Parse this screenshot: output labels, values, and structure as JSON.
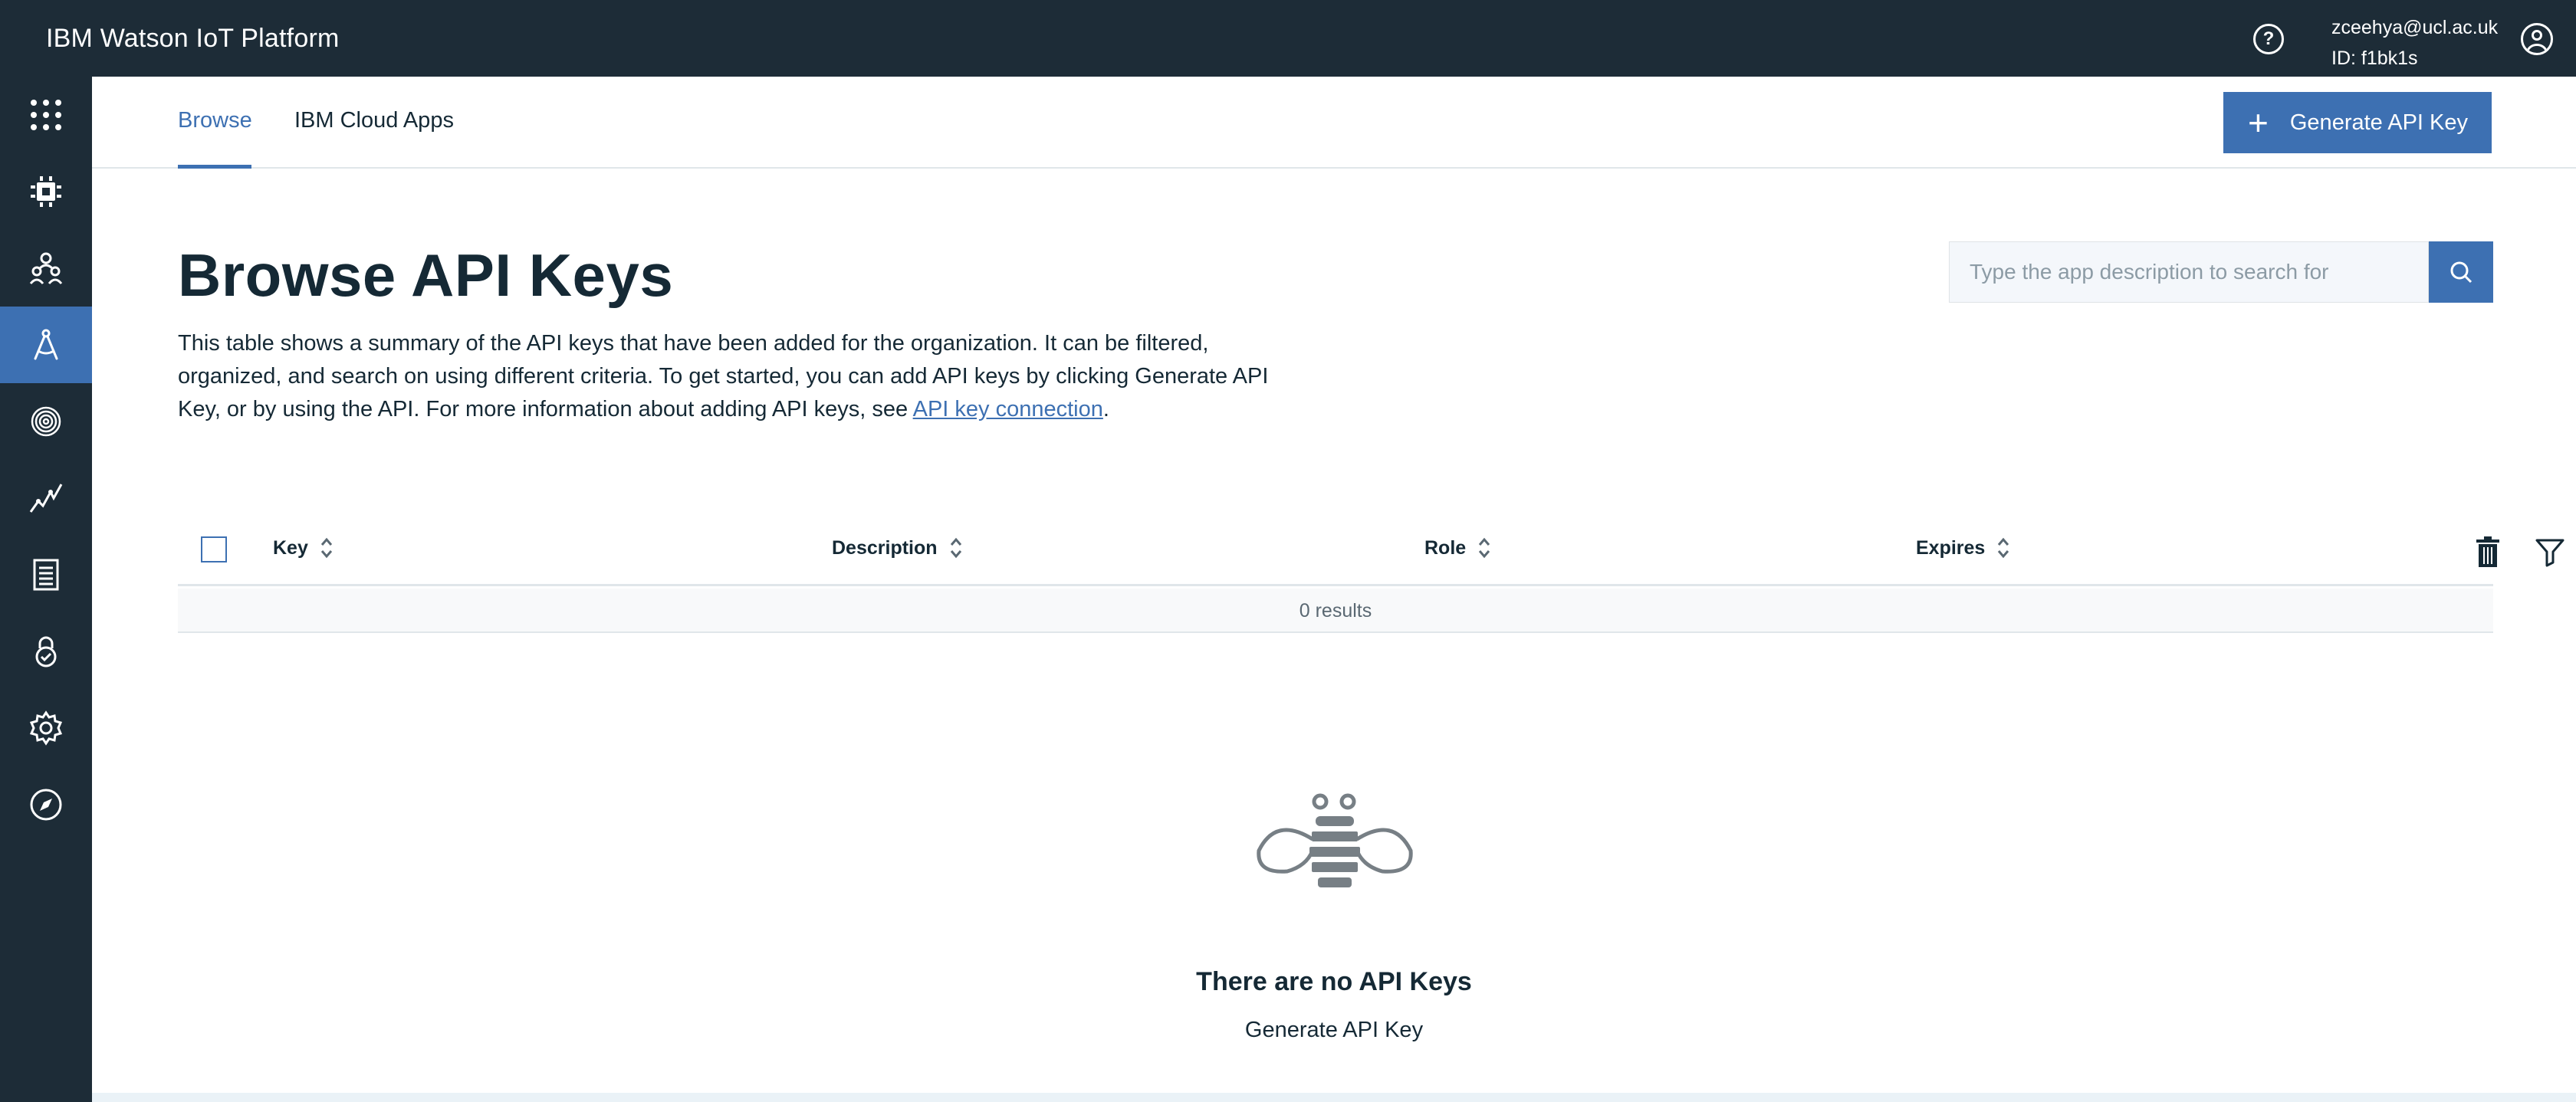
{
  "header": {
    "app_title": "IBM Watson IoT Platform",
    "help_icon": "help-circle-icon",
    "user_email": "zceehya@ucl.ac.uk",
    "user_id": "ID: f1bk1s",
    "user_icon": "user-avatar-icon"
  },
  "sidebar": {
    "items": [
      {
        "icon": "grid-dots-icon",
        "active": false
      },
      {
        "icon": "chip-device-icon",
        "active": false
      },
      {
        "icon": "members-icon",
        "active": false
      },
      {
        "icon": "apps-compass-icon",
        "active": true
      },
      {
        "icon": "fingerprint-icon",
        "active": false
      },
      {
        "icon": "analytics-line-icon",
        "active": false
      },
      {
        "icon": "document-icon",
        "active": false
      },
      {
        "icon": "lock-check-icon",
        "active": false
      },
      {
        "icon": "gear-icon",
        "active": false
      },
      {
        "icon": "compass-icon",
        "active": false
      }
    ],
    "active_color": "#3d70b2",
    "background": "#1d2c37"
  },
  "tabs": [
    {
      "label": "Browse",
      "active": true
    },
    {
      "label": "IBM Cloud Apps",
      "active": false
    }
  ],
  "actions": {
    "generate_button": "Generate API Key"
  },
  "page": {
    "title": "Browse API Keys",
    "description_prefix": "This table shows a summary of the API keys that have been added for the organization. It can be filtered, organized, and search on using different criteria. To get started, you can add API keys by clicking Generate API Key, or by using the API. For more information about adding API keys, see ",
    "description_link": "API key connection",
    "description_suffix": "."
  },
  "search": {
    "placeholder": "Type the app description to search for",
    "value": ""
  },
  "table": {
    "columns": [
      "Key",
      "Description",
      "Role",
      "Expires"
    ],
    "results_text": "0 results",
    "rows": []
  },
  "empty_state": {
    "title": "There are no API Keys",
    "action": "Generate API Key",
    "icon": "bee-icon"
  },
  "colors": {
    "accent": "#3d70b2",
    "topbar": "#1d2c37",
    "text": "#152935"
  }
}
